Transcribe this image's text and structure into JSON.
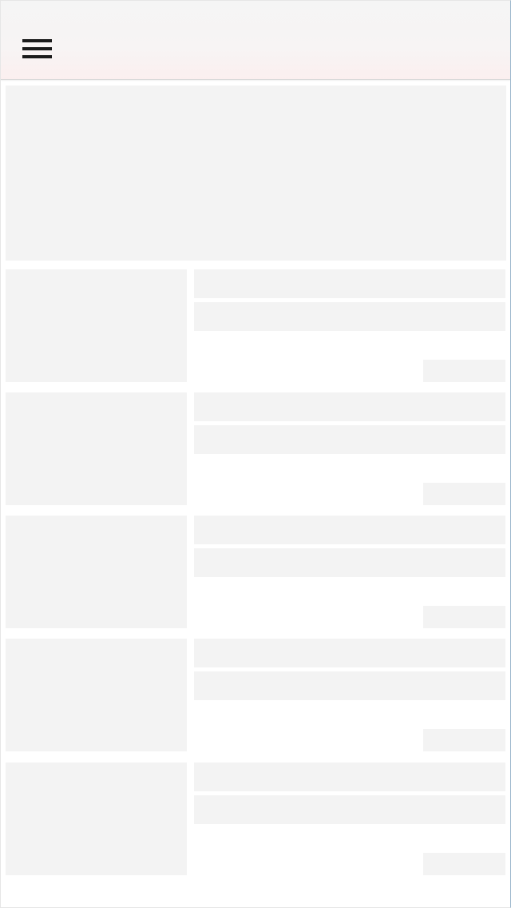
{
  "header": {
    "menu_icon": "hamburger-menu-icon"
  },
  "colors": {
    "placeholder": "#f3f3f3",
    "header_background": "#f5f5f5",
    "icon": "#1a1a1a"
  },
  "feed": {
    "hero": {},
    "items": [
      {},
      {},
      {},
      {},
      {}
    ]
  }
}
